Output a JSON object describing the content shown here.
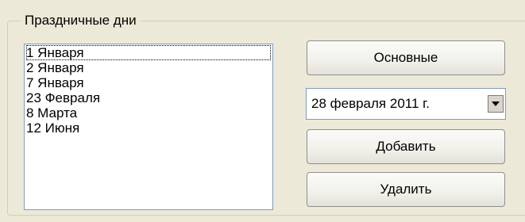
{
  "group": {
    "title": "Праздничные дни"
  },
  "holidays": {
    "items": [
      "1 Января",
      "2 Января",
      "7 Января",
      "23 Февраля",
      "8 Марта",
      "12 Июня"
    ],
    "selected_index": 0
  },
  "buttons": {
    "main_label": "Основные",
    "add_label": "Добавить",
    "delete_label": "Удалить"
  },
  "datepicker": {
    "value": "28 февраля 2011 г.",
    "dropdown_icon": "dropdown-arrow-icon"
  }
}
